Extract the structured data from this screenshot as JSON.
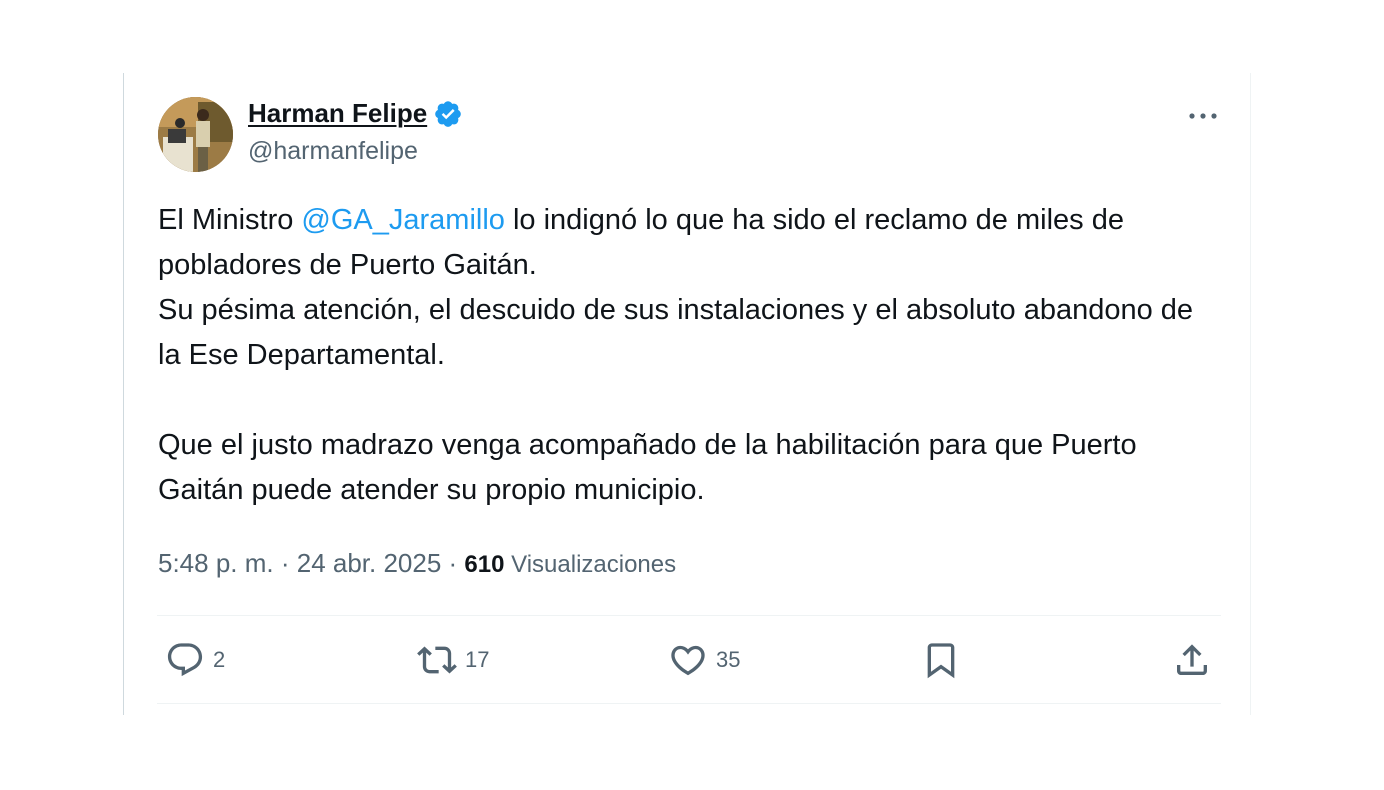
{
  "tweet": {
    "author_name": "Harman Felipe",
    "author_handle": "@harmanfelipe",
    "verified_icon": "verified-badge-icon",
    "more_icon": "more-options-icon",
    "text": {
      "line1_prefix": "El Ministro ",
      "mention": "@GA_Jaramillo",
      "line1_suffix": " lo indignó lo que ha sido el reclamo de miles de pobladores de Puerto Gaitán.",
      "para2": "Su pésima atención, el descuido de sus instalaciones y el absoluto abandono de la Ese Departamental.",
      "para3": "Que el justo madrazo venga acompañado de la habilitación para que Puerto Gaitán puede atender su propio municipio."
    },
    "meta": {
      "time": "5:48 p. m.",
      "separator": " · ",
      "date": "24 abr. 2025",
      "views_count": "610",
      "views_label": " Visualizaciones"
    },
    "actions": {
      "replies": "2",
      "retweets": "17",
      "likes": "35"
    },
    "colors": {
      "accent": "#1d9bf0",
      "secondary_text": "#536471",
      "primary_text": "#0f1419"
    }
  }
}
